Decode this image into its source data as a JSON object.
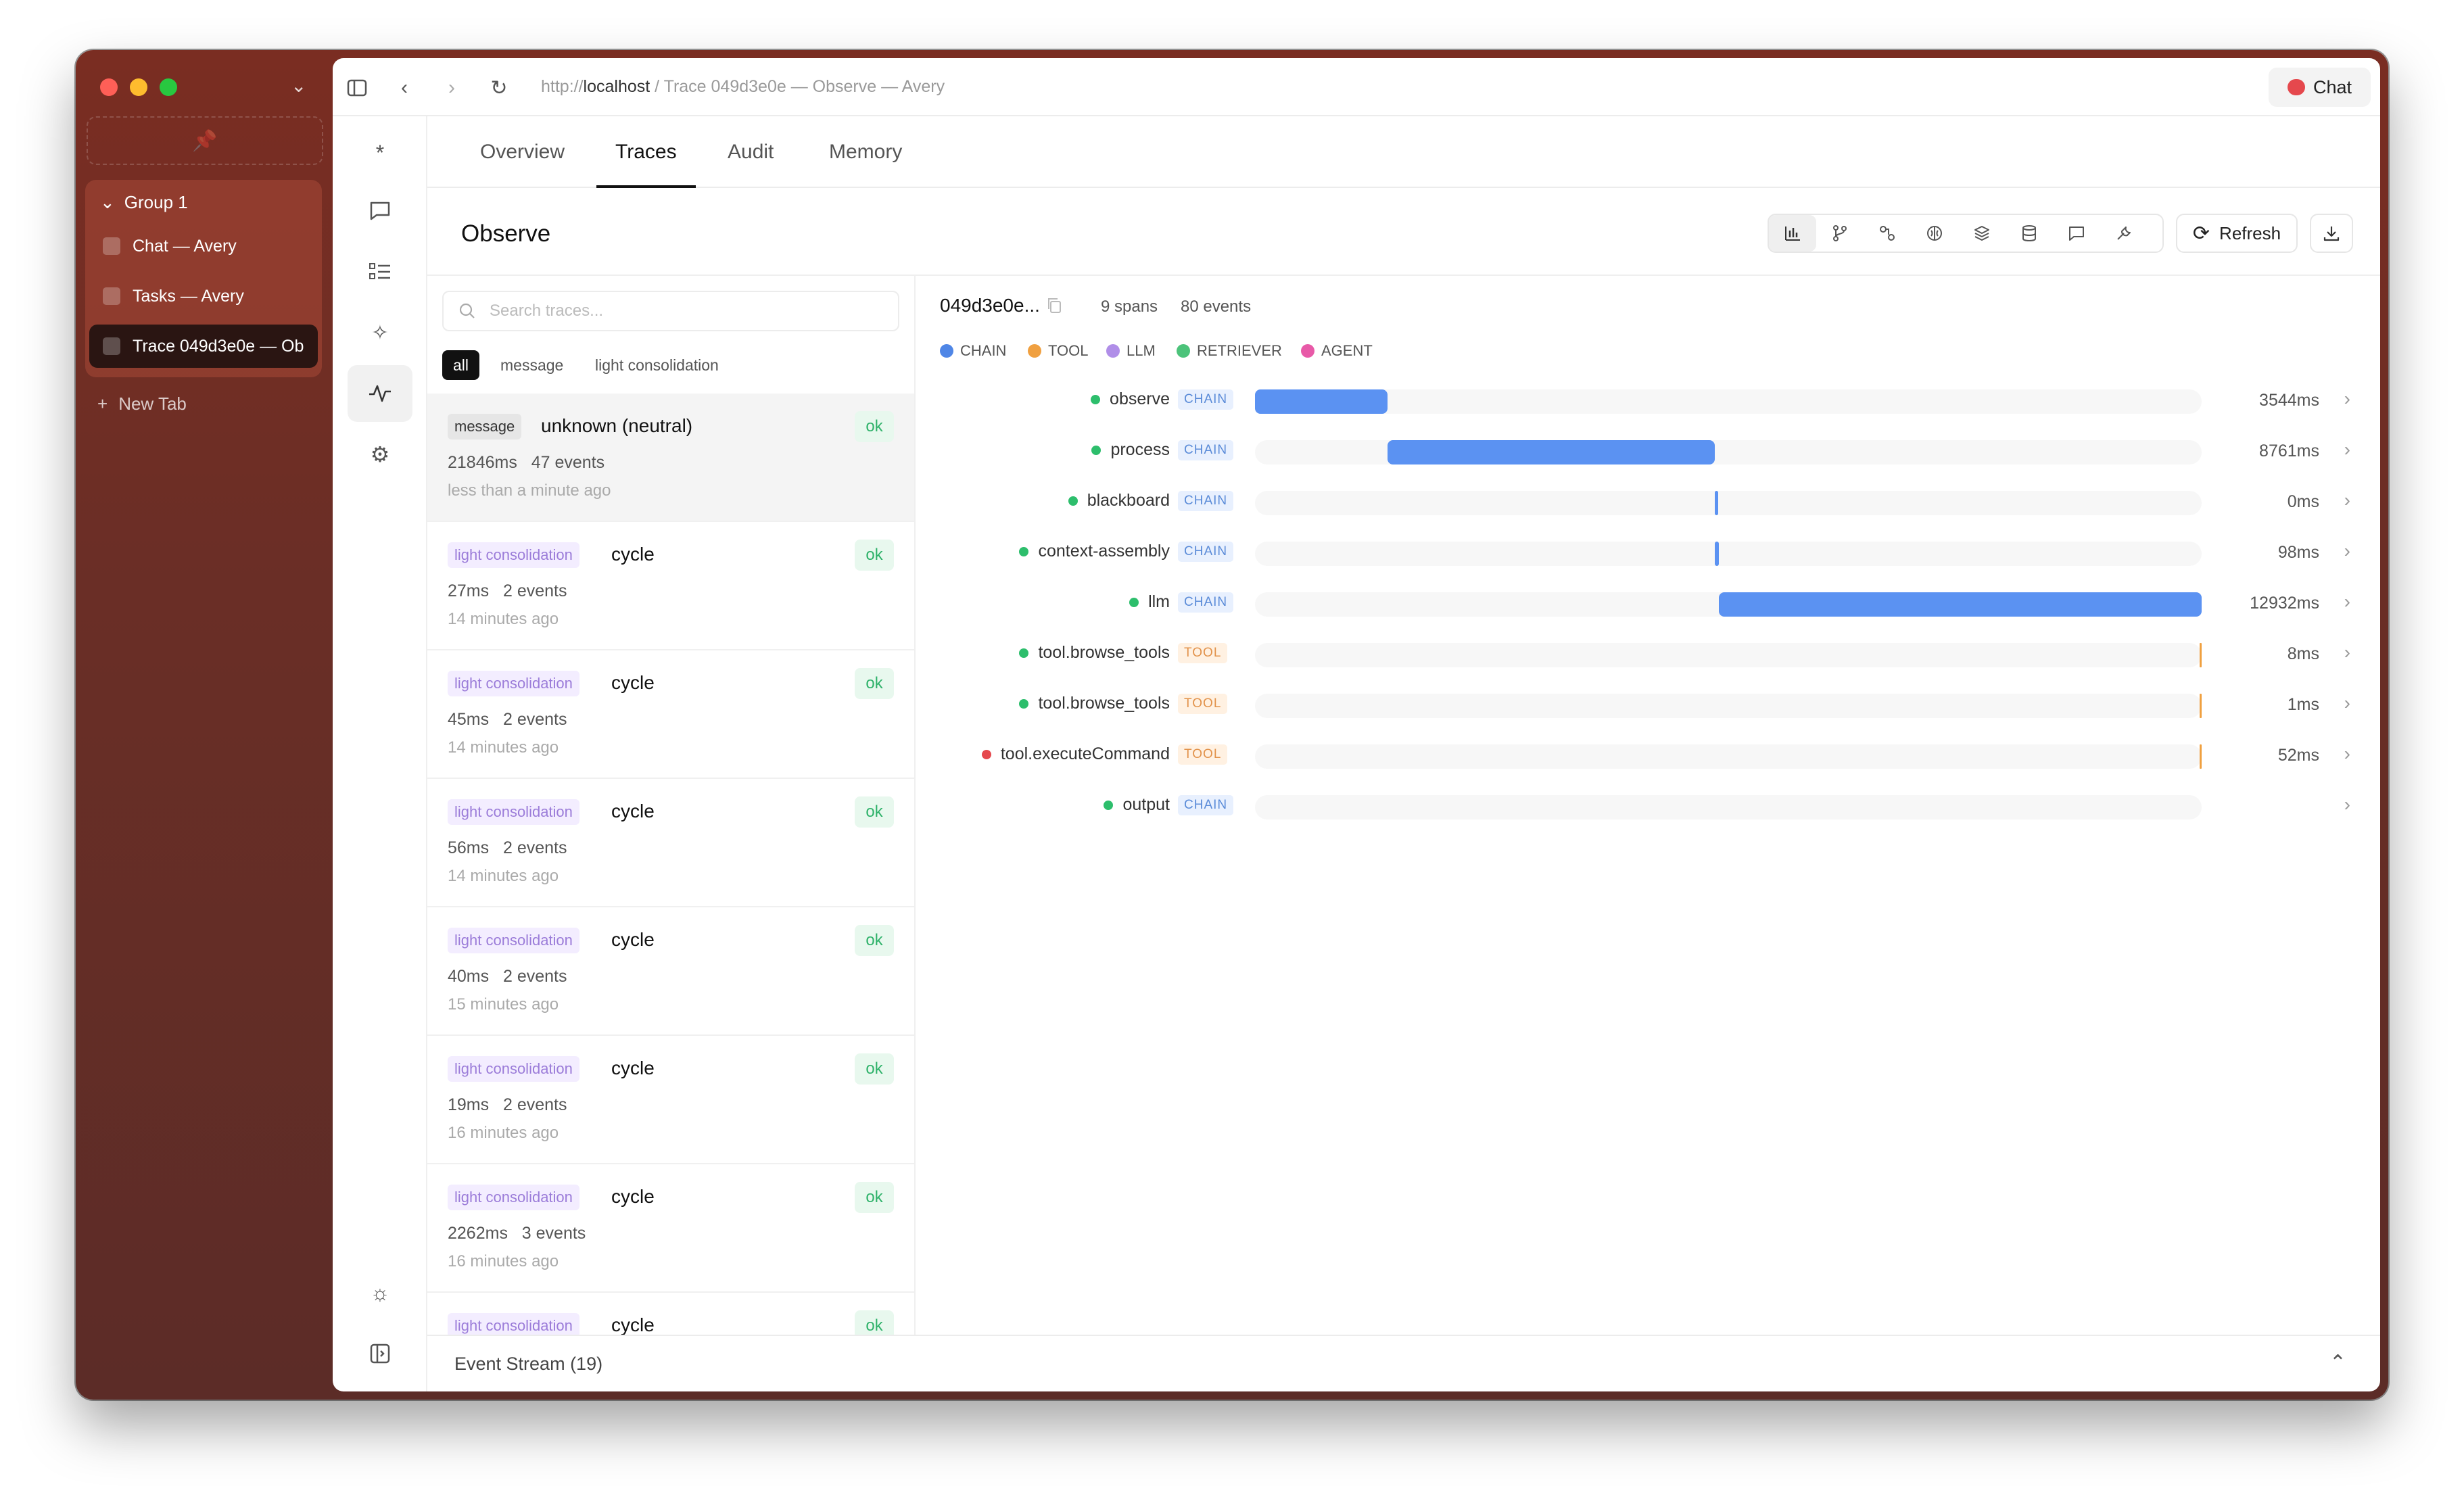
{
  "window": {
    "traffic_lights": [
      "#ff5f57",
      "#febc2e",
      "#28c840"
    ]
  },
  "sidebar": {
    "group_label": "Group 1",
    "tabs": [
      {
        "label": "Chat — Avery"
      },
      {
        "label": "Tasks — Avery"
      },
      {
        "label": "Trace 049d3e0e — Ob"
      }
    ],
    "new_tab_label": "New Tab"
  },
  "urlbar": {
    "scheme": "http://",
    "host": "localhost",
    "rest": " / Trace 049d3e0e — Observe — Avery",
    "chat_label": "Chat"
  },
  "nav": {
    "tabs": [
      "Overview",
      "Traces",
      "Audit",
      "Memory"
    ],
    "active": "Traces"
  },
  "header": {
    "title": "Observe",
    "refresh_label": "Refresh"
  },
  "traces": {
    "search_placeholder": "Search traces...",
    "filters": [
      "all",
      "message",
      "light consolidation"
    ],
    "items": [
      {
        "tag": "message",
        "name": "unknown (neutral)",
        "status": "ok",
        "duration": "21846ms",
        "events": "47 events",
        "ago": "less than a minute ago"
      },
      {
        "tag": "light consolidation",
        "name": "cycle",
        "status": "ok",
        "duration": "27ms",
        "events": "2 events",
        "ago": "14 minutes ago"
      },
      {
        "tag": "light consolidation",
        "name": "cycle",
        "status": "ok",
        "duration": "45ms",
        "events": "2 events",
        "ago": "14 minutes ago"
      },
      {
        "tag": "light consolidation",
        "name": "cycle",
        "status": "ok",
        "duration": "56ms",
        "events": "2 events",
        "ago": "14 minutes ago"
      },
      {
        "tag": "light consolidation",
        "name": "cycle",
        "status": "ok",
        "duration": "40ms",
        "events": "2 events",
        "ago": "15 minutes ago"
      },
      {
        "tag": "light consolidation",
        "name": "cycle",
        "status": "ok",
        "duration": "19ms",
        "events": "2 events",
        "ago": "16 minutes ago"
      },
      {
        "tag": "light consolidation",
        "name": "cycle",
        "status": "ok",
        "duration": "2262ms",
        "events": "3 events",
        "ago": "16 minutes ago"
      },
      {
        "tag": "light consolidation",
        "name": "cycle",
        "status": "ok",
        "duration": "",
        "events": "",
        "ago": ""
      }
    ]
  },
  "timeline": {
    "trace_id": "049d3e0e...",
    "spans": "9 spans",
    "events": "80 events",
    "legend": [
      {
        "label": "CHAIN",
        "color": "#4f86e6"
      },
      {
        "label": "TOOL",
        "color": "#f0a040"
      },
      {
        "label": "LLM",
        "color": "#b08ee8"
      },
      {
        "label": "RETRIEVER",
        "color": "#4cc37a"
      },
      {
        "label": "AGENT",
        "color": "#e85aa8"
      }
    ],
    "rows": [
      {
        "name": "observe",
        "kind": "CHAIN",
        "status_color": "#2dbe6c",
        "duration": "3544ms",
        "start_frac": 0.0,
        "end_frac": 0.14
      },
      {
        "name": "process",
        "kind": "CHAIN",
        "status_color": "#2dbe6c",
        "duration": "8761ms",
        "start_frac": 0.14,
        "end_frac": 0.486
      },
      {
        "name": "blackboard",
        "kind": "CHAIN",
        "status_color": "#2dbe6c",
        "duration": "0ms",
        "start_frac": 0.486,
        "end_frac": 0.486
      },
      {
        "name": "context-assembly",
        "kind": "CHAIN",
        "status_color": "#2dbe6c",
        "duration": "98ms",
        "start_frac": 0.486,
        "end_frac": 0.49
      },
      {
        "name": "llm",
        "kind": "CHAIN",
        "status_color": "#2dbe6c",
        "duration": "12932ms",
        "start_frac": 0.49,
        "end_frac": 1.0
      },
      {
        "name": "tool.browse_tools",
        "kind": "TOOL",
        "status_color": "#2dbe6c",
        "duration": "8ms",
        "start_frac": 0.999,
        "end_frac": 1.0
      },
      {
        "name": "tool.browse_tools",
        "kind": "TOOL",
        "status_color": "#2dbe6c",
        "duration": "1ms",
        "start_frac": 0.999,
        "end_frac": 1.0
      },
      {
        "name": "tool.executeCommand",
        "kind": "TOOL",
        "status_color": "#e5484d",
        "duration": "52ms",
        "start_frac": 0.999,
        "end_frac": 1.0
      },
      {
        "name": "output",
        "kind": "CHAIN",
        "status_color": "#2dbe6c",
        "duration": "",
        "start_frac": null,
        "end_frac": null
      }
    ]
  },
  "event_stream": {
    "label": "Event Stream (19)"
  }
}
